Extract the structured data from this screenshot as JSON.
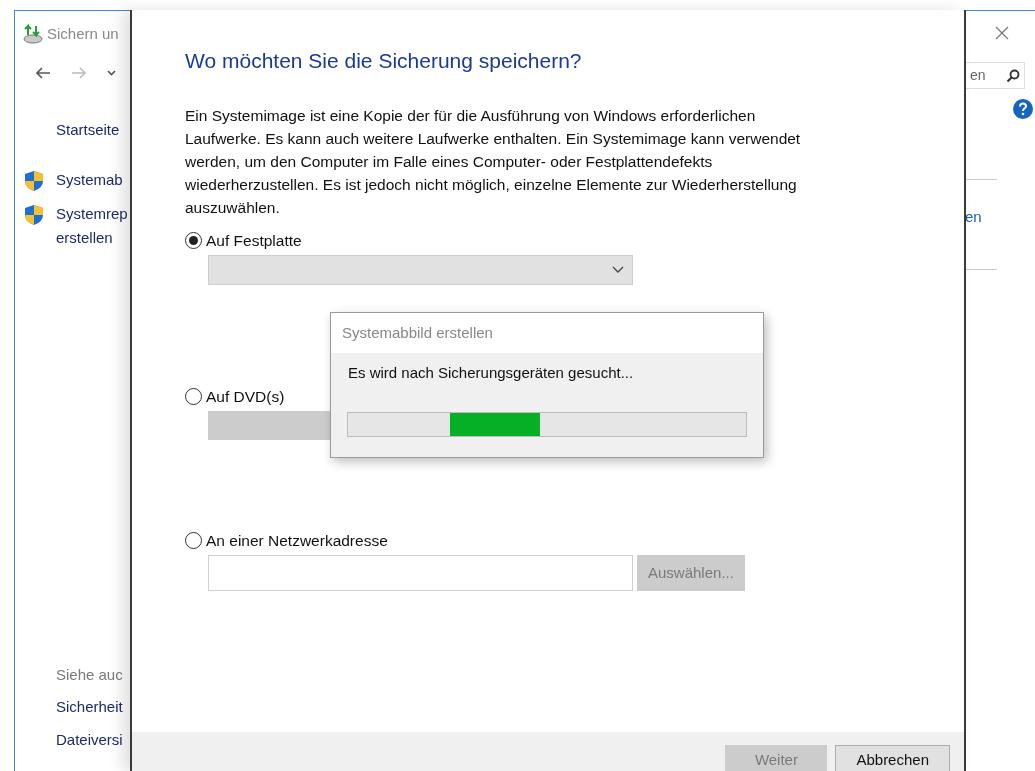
{
  "background_window": {
    "title": "Sichern un",
    "search_text": "en",
    "sidebar": [
      {
        "label": "Startseite",
        "kind": "link"
      },
      {
        "label": "Systemab",
        "kind": "shield"
      },
      {
        "label": "Systemrep\nerstellen",
        "kind": "shield"
      }
    ],
    "see_also": {
      "heading": "Siehe auc",
      "links": [
        "Sicherheit",
        "Dateiversi"
      ]
    },
    "right_link": "en"
  },
  "wizard": {
    "heading": "Wo möchten Sie die Sicherung speichern?",
    "description": "Ein Systemimage ist eine Kopie der für die Ausführung von Windows erforderlichen Laufwerke. Es kann auch weitere Laufwerke enthalten. Ein Systemimage kann verwendet werden, um den Computer im Falle eines Computer- oder Festplattendefekts wiederherzustellen. Es ist jedoch nicht möglich, einzelne Elemente zur Wiederherstellung auszuwählen.",
    "options": [
      {
        "label": "Auf Festplatte",
        "selected": true,
        "kind": "dropdown"
      },
      {
        "label": "Auf DVD(s)",
        "selected": false,
        "kind": "disabled-list"
      },
      {
        "label": "An einer Netzwerkadresse",
        "selected": false,
        "kind": "path",
        "button": {
          "label": "Auswählen...",
          "disabled": true
        }
      }
    ],
    "buttons": [
      {
        "label": "Weiter",
        "disabled": true
      },
      {
        "label": "Abbrechen",
        "disabled": false
      }
    ]
  },
  "progress_dialog": {
    "title": "Systemabbild erstellen",
    "message": "Es wird nach Sicherungsgeräten gesucht..."
  }
}
